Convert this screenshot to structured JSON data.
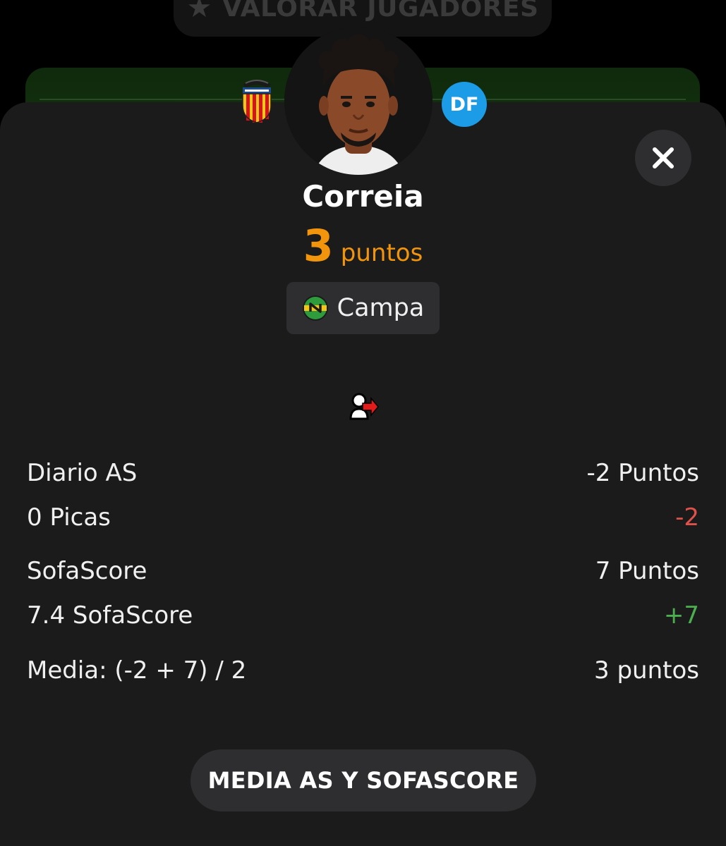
{
  "background": {
    "rate_button_label": "VALORAR JUGADORES",
    "rate_button_icon": "star-icon"
  },
  "player": {
    "name": "Correia",
    "position": "DF",
    "position_color": "#1c9be6",
    "club_badge_icon": "valencia-cf-crest-icon",
    "points_value": "3",
    "points_unit": "puntos",
    "points_color": "#f2950c",
    "owner_name": "Campa",
    "owner_icon": "team-logo-icon",
    "event_icon": "substitution-off-icon"
  },
  "breakdown": {
    "rows": [
      {
        "label": "Diario AS",
        "value": "-2 Puntos"
      },
      {
        "label": "0 Picas",
        "value": "-2",
        "tone": "negative"
      },
      {
        "label": "SofaScore",
        "value": "7 Puntos"
      },
      {
        "label": "7.4 SofaScore",
        "value": "+7",
        "tone": "positive"
      },
      {
        "label": "Media: (-2 + 7) / 2",
        "value": "3 puntos"
      }
    ]
  },
  "actions": {
    "close_icon": "close-icon",
    "cta_label": "MEDIA AS Y SOFASCORE"
  },
  "colors": {
    "sheet_bg": "#1b1b1b",
    "negative": "#e0514a",
    "positive": "#4caf50"
  }
}
